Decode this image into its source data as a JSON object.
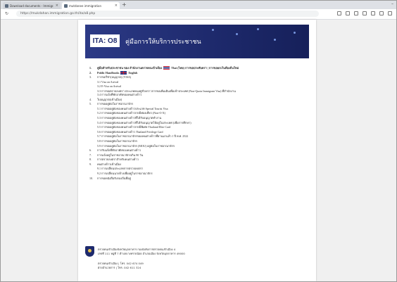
{
  "browser": {
    "tabs": [
      {
        "label": "Download documents - Immigr..."
      },
      {
        "label": "mutdanee immigration"
      }
    ],
    "new_tab": "+",
    "window_controls": "–",
    "url": "https://mukdahan.immigration.go.th/ita/o8.php"
  },
  "banner": {
    "code": "ITA: O8",
    "title": "คู่มือการให้บริการประชาชน"
  },
  "toc": [
    {
      "num": "1.",
      "text": "คู่มือสำหรับประชาชน ของ สำนักงานตรวจคนเข้าเมือง",
      "flag": "th",
      "suffix": "Thai (ไทย) การขอประทับตรา | การขอยกเว้นท้องถิ่นใหม่",
      "bold": true
    },
    {
      "num": "2.",
      "text": "Public Handbooks",
      "flag": "uk",
      "suffix": "English",
      "bold": true
    },
    {
      "num": "3.",
      "text": "การขอวีซ่า(อนุญาต) (VISA)",
      "bold": false
    },
    {
      "num": "",
      "text": "3.1 Visa on Arrival",
      "level": 2
    },
    {
      "num": "",
      "text": "3.2 E-Visa on Arrival",
      "level": 2
    },
    {
      "num": "",
      "text": "3.3 การขอตรวจลงตรา ประเภทคนอยู่ชั่วคราวการขอเพิ่มเติมเพื่อเข้าประเทศ (Non-Quota Immigrant Visa) ที่สำนักงาน",
      "level": 3
    },
    {
      "num": "",
      "text": "3.4 การแจ้งที่พักอาศัยของคนต่างด้าว",
      "level": 2
    },
    {
      "num": "4.",
      "text": "ใบอนุญาต(เข้าเมือง)"
    },
    {
      "num": "5.",
      "text": "การขออยู่ต่อในราชอาณาจักร"
    },
    {
      "num": "",
      "text": "5.1 การขออยู่ต่อของคนต่างด้าวประเภท Special Tourist Visa",
      "level": 2
    },
    {
      "num": "",
      "text": "5.2 การขออยู่ต่อของคนต่างด้าวกรณีท่องเที่ยว (Non-O-X)",
      "level": 2
    },
    {
      "num": "",
      "text": "5.3 การขออยู่ต่อของคนต่างด้าวที่ได้รับอนุญาตทำงาน",
      "level": 2
    },
    {
      "num": "",
      "text": "5.4 การขออยู่ต่อของคนต่างด้าวที่ได้รับอนุญาตให้อยู่ในประเทศ (เพื่อการศึกษา)",
      "level": 2
    },
    {
      "num": "",
      "text": "5.5 การขออยู่ต่อของคนต่างด้าวกรณีพิเศษ Thailand Elite Card",
      "level": 2
    },
    {
      "num": "",
      "text": "5.6 การขออยู่ต่อของคนต่างด้าว Thailand Privilege Card",
      "level": 2
    },
    {
      "num": "",
      "text": "5.7 การขออยู่ต่อในราชอาณาจักรของคนต่างด้าวที่ผ่านมาแล้ว 1 ปี พ.ศ. 2522",
      "level": 2
    },
    {
      "num": "",
      "text": "5.8 การขออยู่ต่อในราชอาณาจักร",
      "level": 2
    },
    {
      "num": "",
      "text": "5.9 การขออยู่ต่อในราชอาณาจักร (MOU) อยู่ต่อในราชอาณาจักร",
      "level": 2
    },
    {
      "num": "6.",
      "text": "การรับแจ้งที่พักอาศัยของคนต่างด้าว"
    },
    {
      "num": "7.",
      "text": "การแจ้งอยู่ในราชอาณาจักรเกิน 90 วัน"
    },
    {
      "num": "8.",
      "text": "การตรวจลงตราสำหรับคนต่างด้าว"
    },
    {
      "num": "9.",
      "text": "คนต่างด้าวเข้าเมือง"
    },
    {
      "num": "",
      "text": "9.1 การเปลี่ยนประเภทการตรวจลงตรา",
      "level": 2
    },
    {
      "num": "",
      "text": "9.2 การเปลี่ยนนายจ้างเพื่ออยู่ในราชอาณาจักร",
      "level": 2
    },
    {
      "num": "10.",
      "text": "การขอหนังสือรับรองถิ่นที่อยู่"
    }
  ],
  "footer": {
    "office": "ตรวจคนเข้าเมืองจังหวัดมุกดาหาร กองบังคับการตรวจคนเข้าเมือง 4",
    "address": "เลขที่ 111 หมู่ที่ 7 ตำบลบางทรายน้อย อำเภอเมือง จังหวัดมุกดาหาร 49000",
    "phone": "ตรวจคนเข้าเมือง | โทร. 042 674 049",
    "phone2": "ฝ่ายอำนวยการ | โทร. 042 611 324"
  }
}
